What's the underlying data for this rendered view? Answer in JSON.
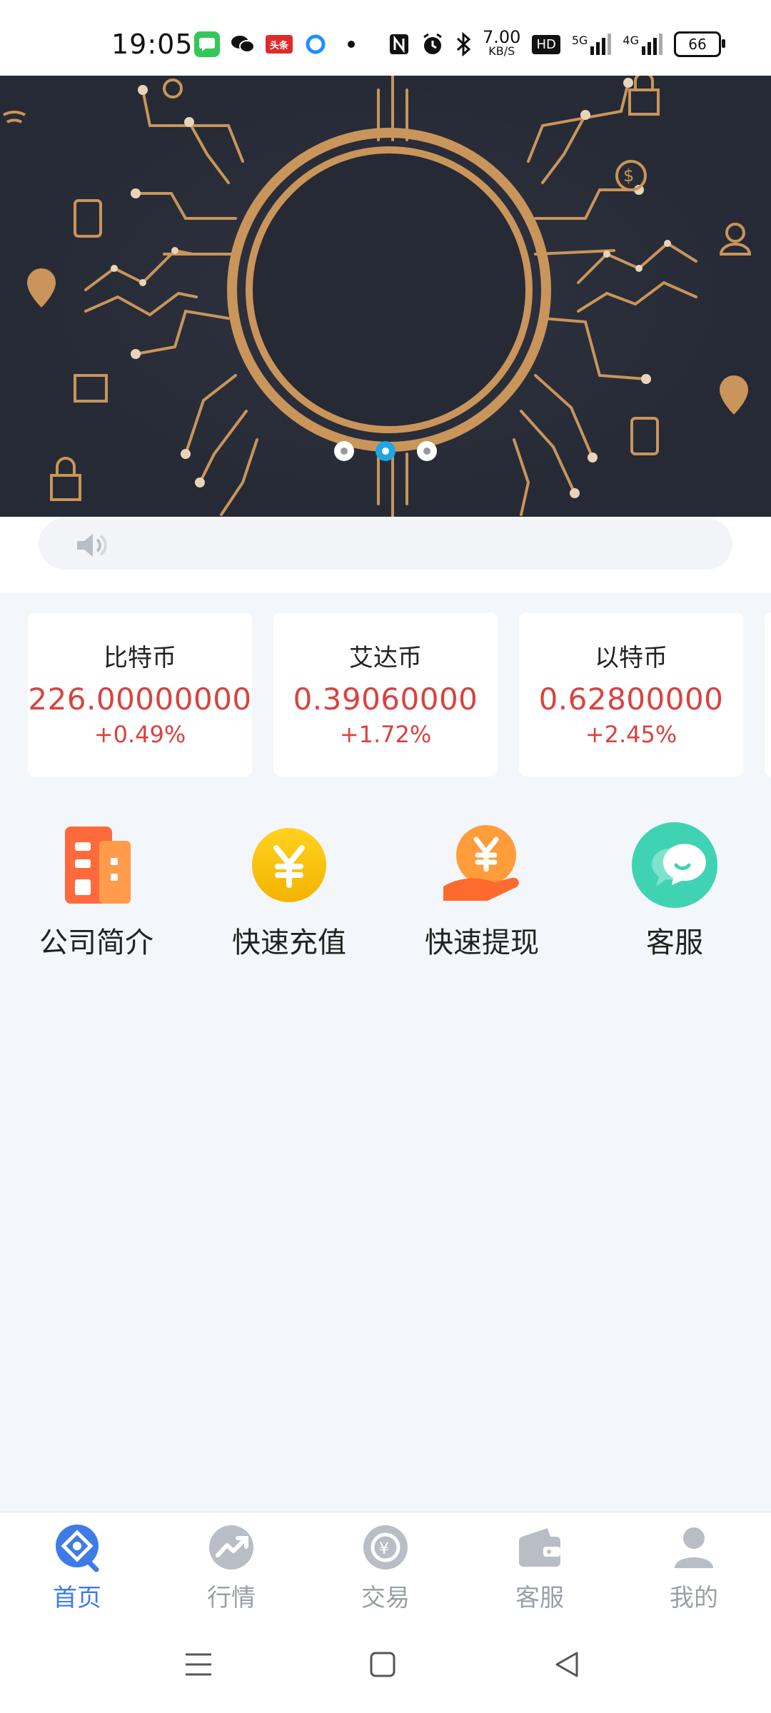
{
  "status_bar": {
    "time": "19:05",
    "net_speed": "7.00",
    "net_unit": "KB/S",
    "hd": "HD",
    "signal1": "5G",
    "signal2": "4G",
    "battery": "66",
    "app_icons": [
      "messages-icon",
      "wechat-icon",
      "toutiao-icon",
      "browser-icon",
      "dot-icon"
    ],
    "sys_icons": [
      "nfc-icon",
      "alarm-icon",
      "bluetooth-icon"
    ]
  },
  "banner": {
    "slides": 3,
    "active_index": 1
  },
  "notice": {
    "icon": "speaker-icon",
    "text": ""
  },
  "coins": [
    {
      "name": "比特币",
      "price": "226.00000000",
      "change": "+0.49%"
    },
    {
      "name": "艾达币",
      "price": "0.39060000",
      "change": "+1.72%"
    },
    {
      "name": "以特币",
      "price": "0.62800000",
      "change": "+2.45%"
    }
  ],
  "quick_actions": [
    {
      "label": "公司简介",
      "icon": "building-icon"
    },
    {
      "label": "快速充值",
      "icon": "yen-coin-icon"
    },
    {
      "label": "快速提现",
      "icon": "yen-hand-icon"
    },
    {
      "label": "客服",
      "icon": "chat-bubble-icon"
    }
  ],
  "tabs": [
    {
      "label": "首页",
      "icon": "home-icon",
      "active": true
    },
    {
      "label": "行情",
      "icon": "trend-icon",
      "active": false
    },
    {
      "label": "交易",
      "icon": "exchange-icon",
      "active": false
    },
    {
      "label": "客服",
      "icon": "wallet-icon",
      "active": false
    },
    {
      "label": "我的",
      "icon": "user-icon",
      "active": false
    }
  ],
  "colors": {
    "accent": "#3e7be6",
    "price_red": "#d9433f",
    "banner_bg": "#2b2f3b",
    "banner_gold": "#c9955a",
    "dot_active": "#1ea6e1"
  }
}
